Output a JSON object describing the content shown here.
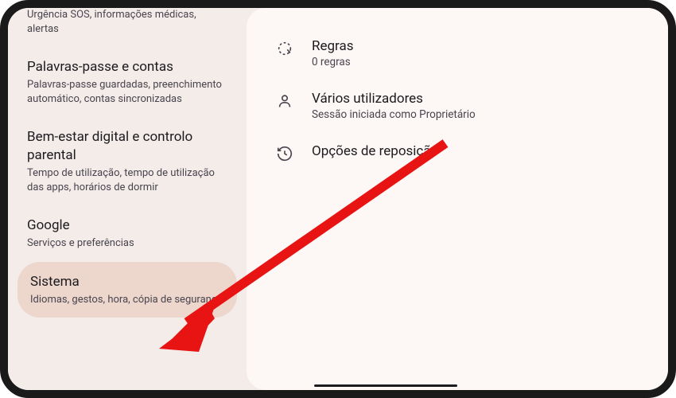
{
  "sidebar": {
    "items": [
      {
        "subtitle": "Urgência SOS, informações médicas, alertas"
      },
      {
        "title": "Palavras-passe e contas",
        "subtitle": "Palavras-passe guardadas, preenchimento automático, contas sincronizadas"
      },
      {
        "title": "Bem-estar digital e controlo parental",
        "subtitle": "Tempo de utilização, tempo de utilização das apps, horários de dormir"
      },
      {
        "title": "Google",
        "subtitle": "Serviços e preferências"
      },
      {
        "title": "Sistema",
        "subtitle": "Idiomas, gestos, hora, cópia de segurança"
      }
    ]
  },
  "main": {
    "items": [
      {
        "title": "Regras",
        "subtitle": "0 regras"
      },
      {
        "title": "Vários utilizadores",
        "subtitle": "Sessão iniciada como Proprietário"
      },
      {
        "title": "Opções de reposição"
      }
    ]
  }
}
